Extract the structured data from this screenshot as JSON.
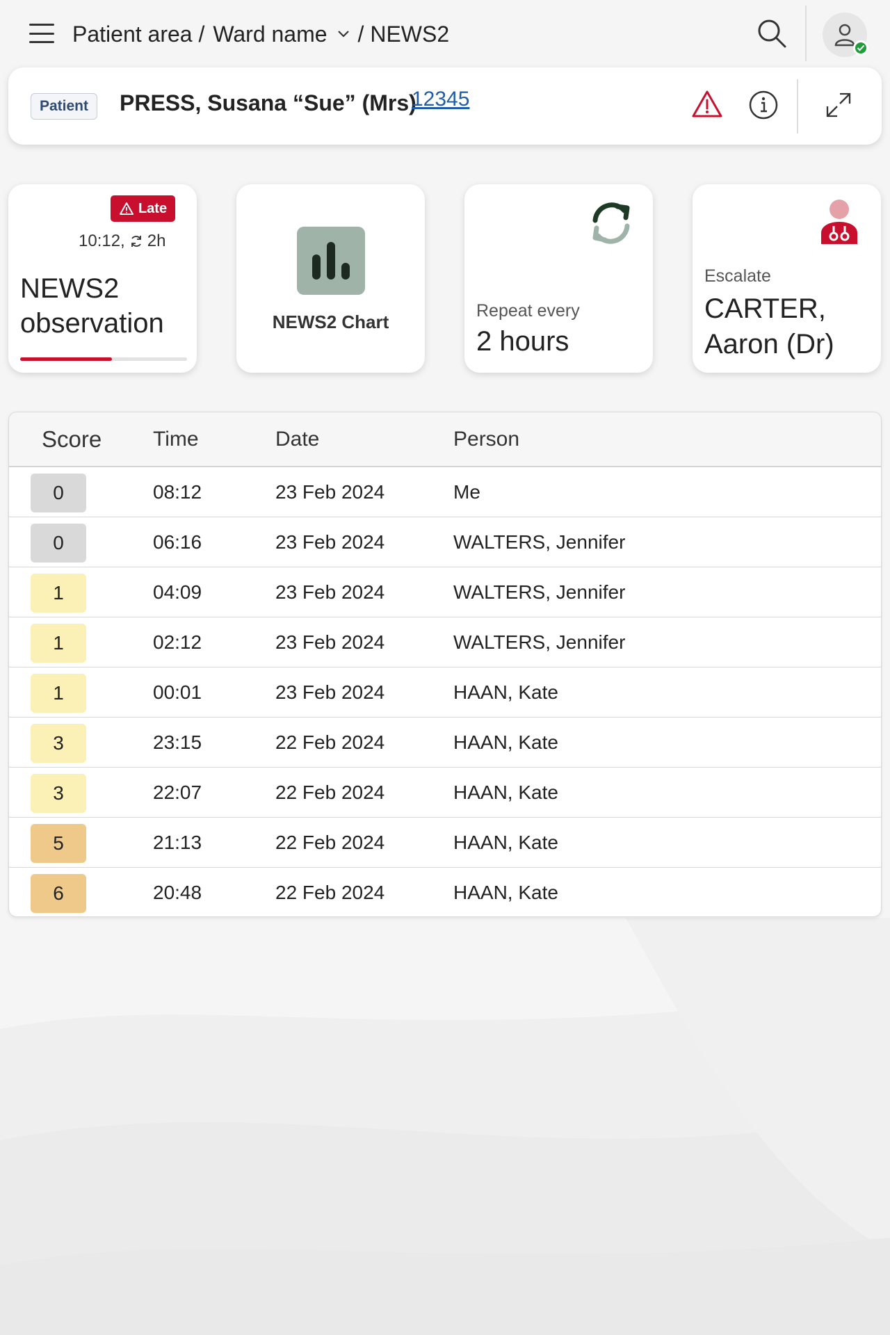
{
  "breadcrumb": {
    "area": "Patient area /",
    "ward": "Ward name",
    "page": "/ NEWS2"
  },
  "patient": {
    "tag": "Patient",
    "name": "PRESS, Susana “Sue” (Mrs)",
    "id": "12345"
  },
  "cards": {
    "observation": {
      "badge": "Late",
      "time": "10:12,",
      "interval": "2h",
      "title_line1": "NEWS2",
      "title_line2": "observation",
      "progress": 0.55
    },
    "chart": {
      "label": "NEWS2 Chart"
    },
    "repeat": {
      "label": "Repeat every",
      "value": "2 hours"
    },
    "escalate": {
      "label": "Escalate",
      "value_line1": "CARTER,",
      "value_line2": "Aaron (Dr)"
    }
  },
  "colors": {
    "alert_red": "#c8102e",
    "link_blue": "#1f5da8",
    "score_0": "#d9d9d9",
    "score_low": "#fbf0b5",
    "score_medium": "#efc98a",
    "online_green": "#1f9d3a"
  },
  "icons": [
    "menu-icon",
    "search-icon",
    "user-icon",
    "warning-icon",
    "info-icon",
    "expand-icon",
    "chart-icon",
    "refresh-icon",
    "doctor-icon"
  ],
  "table": {
    "headers": {
      "score": "Score",
      "time": "Time",
      "date": "Date",
      "person": "Person"
    },
    "rows": [
      {
        "score": "0",
        "time": "08:12",
        "date": "23 Feb 2024",
        "person": "Me"
      },
      {
        "score": "0",
        "time": "06:16",
        "date": "23 Feb 2024",
        "person": "WALTERS, Jennifer"
      },
      {
        "score": "1",
        "time": "04:09",
        "date": "23 Feb 2024",
        "person": "WALTERS, Jennifer"
      },
      {
        "score": "1",
        "time": "02:12",
        "date": "23 Feb 2024",
        "person": "WALTERS, Jennifer"
      },
      {
        "score": "1",
        "time": "00:01",
        "date": "23 Feb 2024",
        "person": "HAAN, Kate"
      },
      {
        "score": "3",
        "time": "23:15",
        "date": "22 Feb 2024",
        "person": "HAAN, Kate"
      },
      {
        "score": "3",
        "time": "22:07",
        "date": "22 Feb 2024",
        "person": "HAAN, Kate"
      },
      {
        "score": "5",
        "time": "21:13",
        "date": "22 Feb 2024",
        "person": "HAAN, Kate"
      },
      {
        "score": "6",
        "time": "20:48",
        "date": "22 Feb 2024",
        "person": "HAAN, Kate"
      }
    ]
  }
}
